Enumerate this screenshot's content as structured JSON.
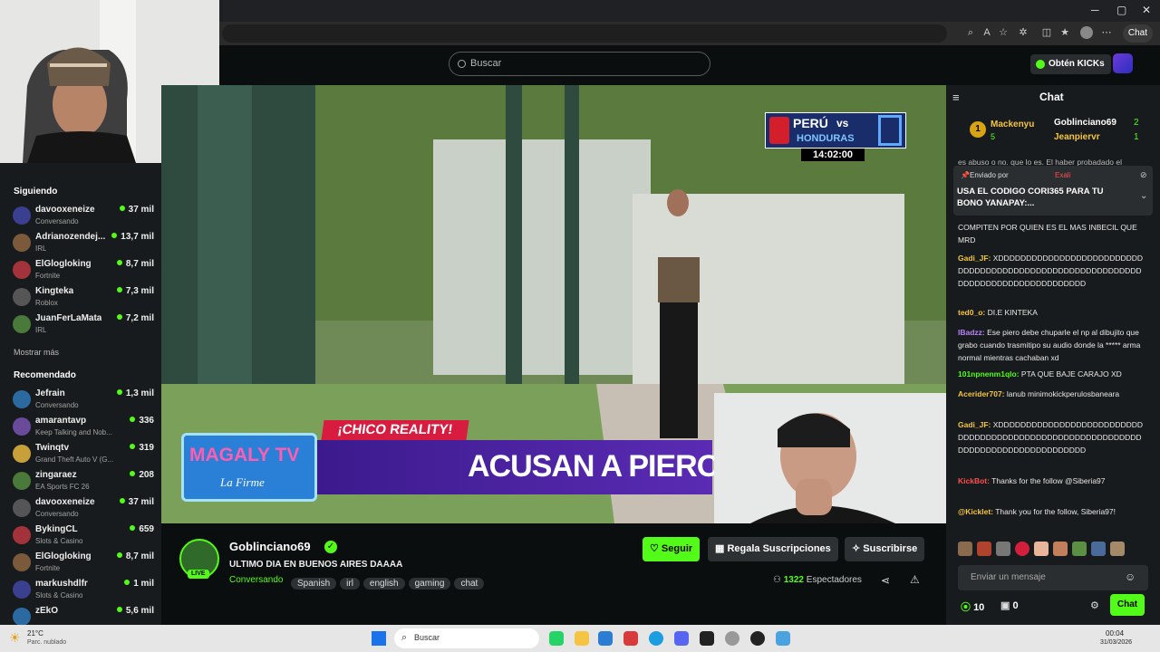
{
  "browser": {
    "chat_button_label": "Chat"
  },
  "header": {
    "search_placeholder": "Buscar",
    "kicks_button": "Obtén KICKs"
  },
  "sidebar": {
    "following_title": "Siguiendo",
    "following": [
      {
        "name": "davooxeneize",
        "category": "Conversando",
        "viewers": "37 mil"
      },
      {
        "name": "Adrianozendej...",
        "category": "IRL",
        "viewers": "13,7 mil"
      },
      {
        "name": "ElGlogloking",
        "category": "Fortnite",
        "viewers": "8,7 mil"
      },
      {
        "name": "Kingteka",
        "category": "Roblox",
        "viewers": "7,3 mil"
      },
      {
        "name": "JuanFerLaMata",
        "category": "IRL",
        "viewers": "7,2 mil"
      }
    ],
    "show_more": "Mostrar más",
    "recommended_title": "Recomendado",
    "recommended": [
      {
        "name": "Jefrain",
        "category": "Conversando",
        "viewers": "1,3 mil"
      },
      {
        "name": "amarantavp",
        "category": "Keep Talking and Nob...",
        "viewers": "336"
      },
      {
        "name": "Twinqtv",
        "category": "Grand Theft Auto V (G...",
        "viewers": "319"
      },
      {
        "name": "zingaraez",
        "category": "EA Sports FC 26",
        "viewers": "208"
      },
      {
        "name": "davooxeneize",
        "category": "Conversando",
        "viewers": "37 mil"
      },
      {
        "name": "BykingCL",
        "category": "Slots & Casino",
        "viewers": "659"
      },
      {
        "name": "ElGlogloking",
        "category": "Fortnite",
        "viewers": "8,7 mil"
      },
      {
        "name": "markushdlfr",
        "category": "Slots & Casino",
        "viewers": "1 mil"
      },
      {
        "name": "zEkO",
        "category": "",
        "viewers": "5,6 mil"
      }
    ]
  },
  "video": {
    "scoreboard_team1": "PERÚ",
    "scoreboard_vs": "vs",
    "scoreboard_team2": "HONDURAS",
    "scoreboard_time": "14:02:00",
    "lower_tag": "¡CHICO REALITY!",
    "logo_main": "MAGALY TV",
    "logo_sub": "La Firme",
    "headline": "ACUSAN A PIERO ARENAS DE A"
  },
  "stream": {
    "live_badge": "LIVE",
    "channel": "Goblinciano69",
    "title": "ULTIMO DIA EN BUENOS AIRES DAAAA",
    "category": "Conversando",
    "tags": [
      "Spanish",
      "irl",
      "english",
      "gaming",
      "chat"
    ],
    "follow": "Seguir",
    "gift_subs": "Regala Suscripciones",
    "subscribe": "Suscribirse",
    "viewers_count": "1322",
    "viewers_label": "Espectadores"
  },
  "chat": {
    "title": "Chat",
    "leaderboard": [
      {
        "rank": "1",
        "name": "Mackenyu",
        "count": "5"
      },
      {
        "name": "Goblinciano69",
        "count": "2"
      },
      {
        "name": "Jeanpiervr",
        "count": "1"
      }
    ],
    "partial_top": "es abuso o no. que lo es. El haber probadado el",
    "pinned_by_label": "Enviado por",
    "pinned_user": "Exali",
    "pinned_text": "USA EL CODIGO CORI365 PARA TU BONO YANAPAY:...",
    "messages": [
      {
        "user": "",
        "text": "COMPITEN POR QUIEN ES EL MAS INBECIL QUE MRD",
        "color": "#e8e8e8"
      },
      {
        "user": "Gadi_JF:",
        "text": "XDDDDDDDDDDDDDDDDDDDDDDDDDDDDDDDDDDDDDDDDDDDDDDDDDDDDDDDDDDDDDDDDDDDDDDDDDDDDDDDDDD",
        "color": "#f4c542"
      },
      {
        "user": "ted0_o:",
        "text": "DI.E KINTEKA",
        "color": "#f4c542"
      },
      {
        "user": "lBadzz:",
        "text": "Ese piero debe chuparle el np al dibujito que grabo cuando trasmitipo su audio donde la ***** arma normal mientras cachaban xd",
        "color": "#b784f7"
      },
      {
        "user": "101npnenm1qlo:",
        "text": "PTA QUE BAJE CARAJO XD",
        "color": "#53fc18"
      },
      {
        "user": "Acerider707:",
        "text": "lanub minimokickperulosbaneara",
        "color": "#f4c542"
      },
      {
        "user": "Gadi_JF:",
        "text": "XDDDDDDDDDDDDDDDDDDDDDDDDDDDDDDDDDDDDDDDDDDDDDDDDDDDDDDDDDDDDDDDDDDDDDDDDDDDDDDDDDD",
        "color": "#f4c542"
      },
      {
        "user": "KickBot:",
        "text": "Thanks for the follow @Siberia97",
        "color": "#ff4d4d"
      },
      {
        "user": "@Kicklet:",
        "text": "Thank you for the follow, Siberia97!",
        "color": "#f4c542"
      }
    ],
    "input_placeholder": "Enviar un mensaje",
    "points": "10",
    "gifts": "0",
    "send": "Chat"
  },
  "taskbar": {
    "weather_temp": "21°C",
    "weather_desc": "Parc. nublado",
    "search": "Buscar",
    "time": "00:04",
    "date": "31/03/2026"
  }
}
